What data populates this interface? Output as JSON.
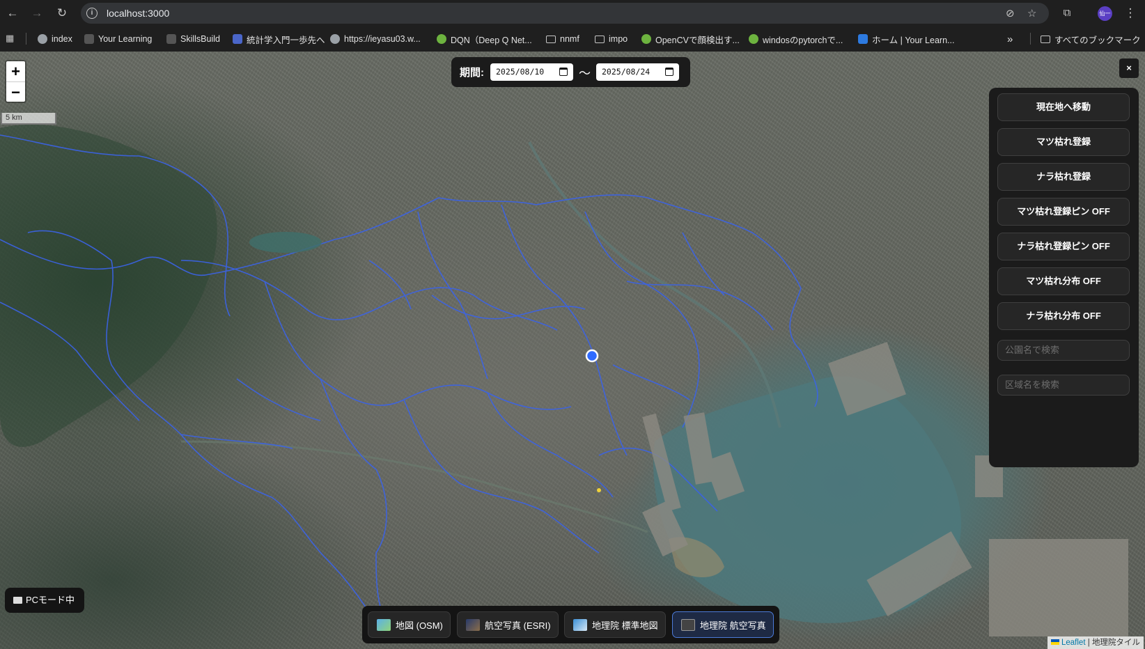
{
  "browser": {
    "url": "localhost:3000",
    "profile_initial": "仙一",
    "bookmarks": [
      {
        "label": "index",
        "icon": "globe-icon"
      },
      {
        "label": "Your Learning",
        "icon": "ibm-icon"
      },
      {
        "label": "SkillsBuild",
        "icon": "skillsbuild-icon"
      },
      {
        "label": "統計学入門一歩先へ",
        "icon": "blue-logo-icon"
      },
      {
        "label": "https://ieyasu03.w...",
        "icon": "globe-icon"
      },
      {
        "label": "DQN（Deep Q Net...",
        "icon": "qiita-icon"
      },
      {
        "label": "nnmf",
        "icon": "folder-icon"
      },
      {
        "label": "impo",
        "icon": "folder-icon"
      },
      {
        "label": "OpenCVで顔検出す...",
        "icon": "qiita-icon"
      },
      {
        "label": "windosのpytorchで...",
        "icon": "qiita-icon"
      },
      {
        "label": "ホーム | Your Learn...",
        "icon": "learn-icon"
      }
    ],
    "more_label": "»",
    "all_bookmarks_label": "すべてのブックマーク"
  },
  "map": {
    "zoom_in": "+",
    "zoom_out": "−",
    "scale_label": "5 km",
    "period": {
      "label": "期間:",
      "start": "2025/08/10",
      "separator": "〜",
      "end": "2025/08/24"
    },
    "close_label": "×",
    "panel": {
      "buttons": [
        "現在地へ移動",
        "マツ枯れ登録",
        "ナラ枯れ登録",
        "マツ枯れ登録ピン OFF",
        "ナラ枯れ登録ピン OFF",
        "マツ枯れ分布 OFF",
        "ナラ枯れ分布 OFF"
      ],
      "park_search_placeholder": "公園名で検索",
      "ward_search_placeholder": "区域名を検索"
    },
    "layers": [
      {
        "label": "地図 (OSM)",
        "active": false
      },
      {
        "label": "航空写真 (ESRI)",
        "active": false
      },
      {
        "label": "地理院 標準地図",
        "active": false
      },
      {
        "label": "地理院 航空写真",
        "active": true
      }
    ],
    "mode_label": "PCモード中",
    "attribution": {
      "leaflet": "Leaflet",
      "separator": "|",
      "source": "地理院タイル"
    },
    "colors": {
      "boundary": "#3b63e8",
      "location_marker": "#2f6bff",
      "active_layer_border": "#4c7bd9"
    }
  }
}
